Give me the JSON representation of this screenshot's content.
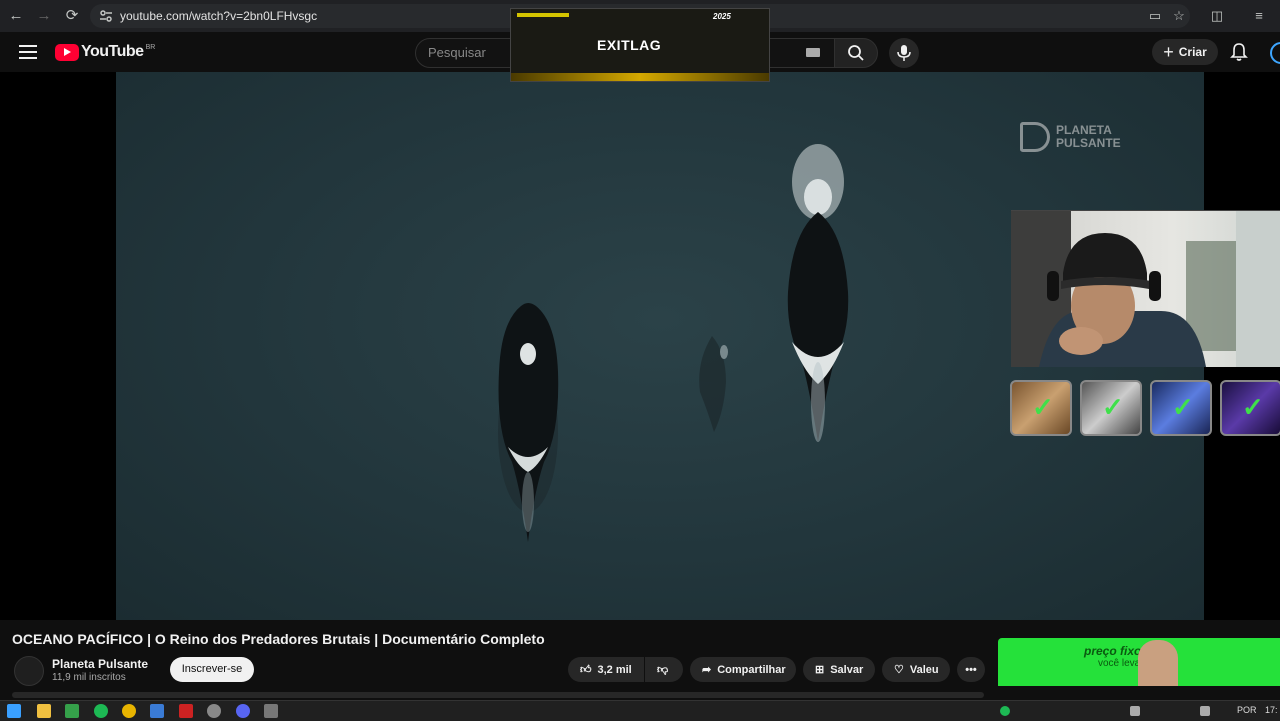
{
  "browser": {
    "url": "youtube.com/watch?v=2bn0LFHvsgc"
  },
  "youtube": {
    "logo_text": "YouTube",
    "region": "BR",
    "search_placeholder": "Pesquisar",
    "create_label": "Criar"
  },
  "ad_overlay": {
    "brand": "EXITLAG",
    "tag": "2025"
  },
  "video": {
    "watermark": [
      "PLANETA",
      "PULSANTE"
    ],
    "title": "OCEANO PACÍFICO | O Reino dos Predadores Brutais | Documentário Completo"
  },
  "channel": {
    "name": "Planeta Pulsante",
    "subscribers": "11,9 mil inscritos",
    "subscribe_label": "Inscrever-se"
  },
  "actions": {
    "likes": "3,2 mil",
    "share_label": "Compartilhar",
    "save_label": "Salvar",
    "thanks_label": "Valeu"
  },
  "ad_banner": {
    "headline": "preço fixo",
    "sub": "você leva"
  },
  "taskbar": {
    "lang": "POR",
    "time": "17:"
  },
  "colors": {
    "yt_red": "#ff0033",
    "ad_green": "#25e13a",
    "accent_blue": "#3ea6ff"
  }
}
